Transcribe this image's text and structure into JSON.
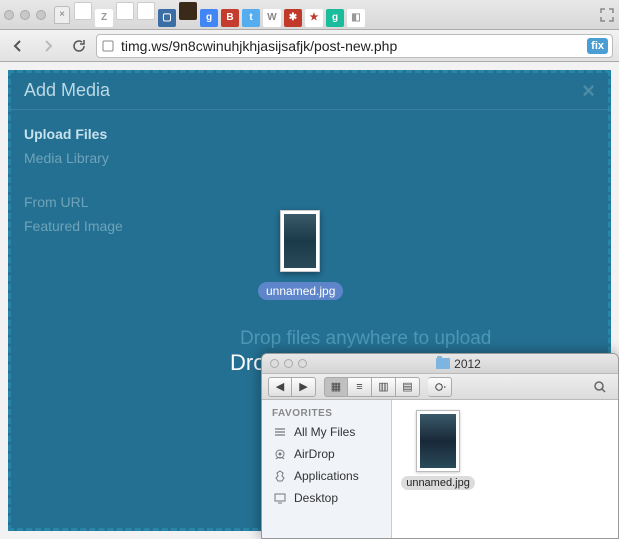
{
  "browser": {
    "url": "timg.ws/9n8cwinuhjkhjasijsafjk/post-new.php",
    "fix_label": "fix",
    "favicons": [
      {
        "bg": "#fff",
        "txt": "",
        "border": "#ccc"
      },
      {
        "bg": "#fff",
        "txt": "Z",
        "fg": "#999"
      },
      {
        "bg": "#fff",
        "txt": "",
        "border": "#ccc"
      },
      {
        "bg": "#fff",
        "txt": "",
        "border": "#ccc"
      },
      {
        "bg": "#3a6ea5",
        "txt": "▢",
        "fg": "#fff"
      },
      {
        "bg": "#3a2a1a",
        "txt": "",
        "border": ""
      },
      {
        "bg": "#4285f4",
        "txt": "g",
        "fg": "#fff"
      },
      {
        "bg": "#c43c2e",
        "txt": "B",
        "fg": "#fff"
      },
      {
        "bg": "#55acee",
        "txt": "t",
        "fg": "#fff"
      },
      {
        "bg": "#fff",
        "txt": "W",
        "fg": "#888"
      },
      {
        "bg": "#c0392b",
        "txt": "✱",
        "fg": "#fff"
      },
      {
        "bg": "#fff",
        "txt": "★",
        "fg": "#c0392b"
      },
      {
        "bg": "#1abc9c",
        "txt": "g",
        "fg": "#fff"
      },
      {
        "bg": "#fff",
        "txt": "◧",
        "fg": "#999"
      }
    ]
  },
  "modal": {
    "title": "Add Media",
    "close": "×",
    "side_groups": [
      {
        "items": [
          {
            "label": "Upload Files",
            "active": true
          },
          {
            "label": "Media Library",
            "active": false
          }
        ]
      },
      {
        "items": [
          {
            "label": "From URL",
            "active": false
          },
          {
            "label": "Featured Image",
            "active": false
          }
        ]
      }
    ],
    "drag_filename": "unnamed.jpg",
    "hint_dim": "Drop files anywhere to upload",
    "hint_main": "Drop files to upload"
  },
  "finder": {
    "title": "2012",
    "favorites_label": "FAVORITES",
    "items": [
      {
        "icon": "all",
        "label": "All My Files"
      },
      {
        "icon": "airdrop",
        "label": "AirDrop"
      },
      {
        "icon": "apps",
        "label": "Applications"
      },
      {
        "icon": "desktop",
        "label": "Desktop"
      }
    ],
    "file": {
      "name": "unnamed.jpg"
    }
  }
}
